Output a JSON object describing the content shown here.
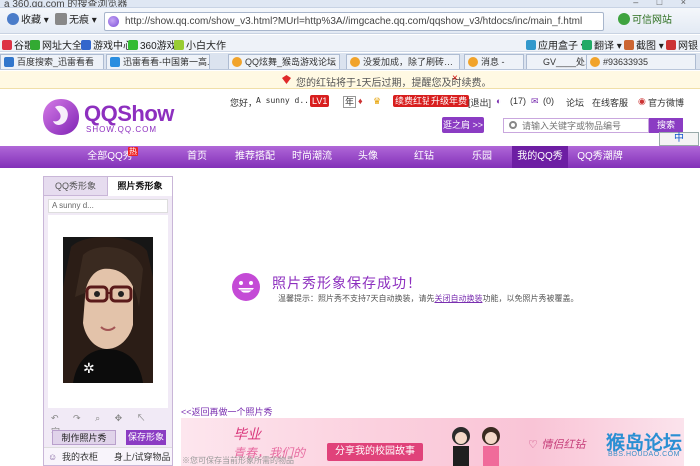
{
  "browser": {
    "title_fragment": "a 360.qq.com 的搜查浏览器",
    "back_label": "收藏",
    "menu_label": "无痕",
    "url": "http://show.qq.com/show_v3.html?MUrl=http%3A//imgcache.qq.com/qqshow_v3/htdocs/inc/main_f.html",
    "trust_label": "可信网站",
    "favorites": [
      "谷歌",
      "网址大全",
      "游戏中心",
      "360游戏",
      "小白大作"
    ],
    "favorites_right": [
      "应用盒子",
      "翻译",
      "截图",
      "网银"
    ],
    "tabs": [
      "百度搜索_迅雷看看",
      "迅雷看看-中国第一高...",
      "QQ炫舞_猴岛游戏论坛",
      "没爱加成，除了刷砖…",
      "消息 -",
      "GV____处...",
      "#93633935"
    ],
    "notice": "您的红钻将于1天后过期，提醒您及时续费。",
    "notice_close": "×"
  },
  "header": {
    "logo_text": "QQShow",
    "logo_sub": "SHOW.QQ.COM",
    "greeting": "您好，",
    "username": "A sunny d...",
    "level_badge": "LV1",
    "year_label": "年",
    "renew_red": "续费红钻",
    "upgrade_year": "升级年费",
    "logout": "[退出]",
    "count_17": "(17)",
    "count_0": "(0)",
    "forum": "论坛",
    "service": "在线客服",
    "weibo": "官方微博",
    "enter_button": "逛之肩 >>",
    "search_placeholder": "请输入关键字或物品编号",
    "search_button": "搜索",
    "ime": "中"
  },
  "nav": {
    "items": [
      "全部QQ秀",
      "首页",
      "推荐搭配",
      "时尚潮流",
      "头像",
      "红钻",
      "乐园",
      "我的QQ秀",
      "QQ秀潮牌"
    ],
    "active_index": 7,
    "hot_badge": "热"
  },
  "left_panel": {
    "tab_qqshow": "QQ秀形象",
    "tab_photo": "照片秀形象",
    "name": "A sunny d...",
    "tools": "↶ ↷ ⌕ ✥ ↖ 字",
    "make_button": "制作照片秀",
    "save_button": "保存形象",
    "bottom_items": [
      "我的衣柜",
      "身上/试穿物品"
    ]
  },
  "main": {
    "success_title": "照片秀形象保存成功！",
    "hint_prefix": "温馨提示：照片秀不支持7天自动换装，请先",
    "hint_link": "关闭自动换装",
    "hint_suffix": "功能，以免照片秀被覆盖。",
    "back_link": "<<返回再做一个照片秀",
    "banner_story": "分享我的校园故事",
    "banner_grad": "毕业",
    "banner_grad2": "青春，我们的",
    "banner_lovers": "情侣红钻",
    "caption": "※您可保存当前形象所需的物品"
  },
  "watermark": {
    "main": "猴岛论坛",
    "sub": "BBS.HOUDAO.COM"
  },
  "colors": {
    "brand_purple": "#8d2fbf",
    "nav_purple": "#8230b8",
    "alert_red": "#d81e1e"
  }
}
